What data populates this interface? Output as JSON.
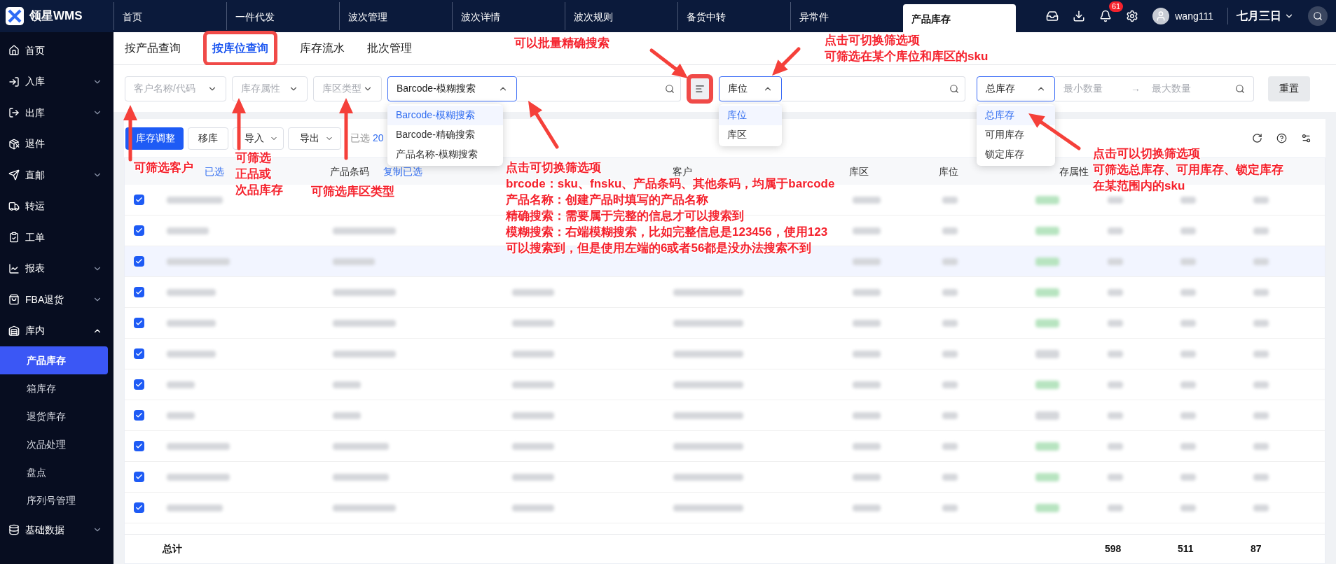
{
  "app": {
    "name": "领星WMS"
  },
  "top_tabs": [
    {
      "label": "首页",
      "selected": false
    },
    {
      "label": "一件代发",
      "selected": false
    },
    {
      "label": "波次管理",
      "selected": false
    },
    {
      "label": "波次详情",
      "selected": false
    },
    {
      "label": "波次规则",
      "selected": false
    },
    {
      "label": "备货中转",
      "selected": false
    },
    {
      "label": "异常件",
      "selected": false
    },
    {
      "label": "产品库存",
      "selected": true
    }
  ],
  "top_right": {
    "notification_count": "61",
    "user": "wang111",
    "date": "七月三日"
  },
  "sidebar": {
    "items": [
      {
        "label": "首页"
      },
      {
        "label": "入库",
        "expanded": false
      },
      {
        "label": "出库",
        "expanded": false
      },
      {
        "label": "退件"
      },
      {
        "label": "直邮",
        "expanded": false
      },
      {
        "label": "转运"
      },
      {
        "label": "工单"
      },
      {
        "label": "报表",
        "expanded": false
      },
      {
        "label": "FBA退货",
        "expanded": false
      },
      {
        "label": "库内",
        "expanded": true,
        "children": [
          {
            "label": "产品库存",
            "selected": true
          },
          {
            "label": "箱库存",
            "selected": false
          },
          {
            "label": "退货库存",
            "selected": false
          },
          {
            "label": "次品处理",
            "selected": false
          },
          {
            "label": "盘点",
            "selected": false
          },
          {
            "label": "序列号管理",
            "selected": false
          }
        ]
      },
      {
        "label": "基础数据",
        "expanded": false
      }
    ]
  },
  "sub_tabs": [
    {
      "label": "按产品查询",
      "selected": false
    },
    {
      "label": "按库位查询",
      "selected": true
    },
    {
      "label": "库存流水",
      "selected": false
    },
    {
      "label": "批次管理",
      "selected": false
    }
  ],
  "filters": {
    "customer": {
      "placeholder": "客户名称/代码"
    },
    "stock_attribute": {
      "placeholder": "库存属性"
    },
    "zone_type": {
      "placeholder": "库区类型"
    },
    "barcode_mode": {
      "value": "Barcode-模糊搜索",
      "options": [
        {
          "label": "Barcode-模糊搜索",
          "selected": true
        },
        {
          "label": "Barcode-精确搜索",
          "selected": false
        },
        {
          "label": "产品名称-模糊搜索",
          "selected": false
        }
      ]
    },
    "location_mode": {
      "value": "库位",
      "options": [
        {
          "label": "库位",
          "selected": true
        },
        {
          "label": "库区",
          "selected": false
        }
      ]
    },
    "quantity_mode": {
      "value": "总库存",
      "options": [
        {
          "label": "总库存",
          "selected": true
        },
        {
          "label": "可用库存",
          "selected": false
        },
        {
          "label": "锁定库存",
          "selected": false
        }
      ]
    },
    "min": {
      "placeholder": "最小数量"
    },
    "arrow": "→",
    "max": {
      "placeholder": "最大数量"
    },
    "reset": "重置"
  },
  "toolbar": {
    "buttons": [
      {
        "label": "库存调整",
        "kind": "primary"
      },
      {
        "label": "移库",
        "kind": "plain"
      },
      {
        "label": "导入",
        "kind": "menu"
      },
      {
        "label": "导出",
        "kind": "menu"
      }
    ],
    "selected_text": "已选",
    "selected_count": "20"
  },
  "table": {
    "columns": [
      {
        "label": "已选",
        "kind": "link"
      },
      {
        "label": "产品条码",
        "kind": "text"
      },
      {
        "label": "复制已选",
        "kind": "link"
      },
      {
        "label": "客户",
        "kind": "text"
      },
      {
        "label": "库区",
        "kind": "text"
      },
      {
        "label": "库位",
        "kind": "text"
      },
      {
        "label": "存属性",
        "kind": "text"
      }
    ],
    "rows": [
      {
        "checked": true,
        "hovered": false,
        "good": true
      },
      {
        "checked": true,
        "hovered": false,
        "good": true
      },
      {
        "checked": true,
        "hovered": true,
        "good": true
      },
      {
        "checked": true,
        "hovered": false,
        "good": true
      },
      {
        "checked": true,
        "hovered": false,
        "good": true
      },
      {
        "checked": true,
        "hovered": false,
        "good": false
      },
      {
        "checked": true,
        "hovered": false,
        "good": true
      },
      {
        "checked": true,
        "hovered": false,
        "good": false
      },
      {
        "checked": true,
        "hovered": false,
        "good": true
      },
      {
        "checked": true,
        "hovered": false,
        "good": true
      },
      {
        "checked": true,
        "hovered": false,
        "good": true
      }
    ],
    "total": {
      "label": "总计",
      "values": [
        "598",
        "511",
        "87"
      ]
    }
  },
  "annotations": {
    "batch": "可以批量精确搜索",
    "location": [
      "点击可切换筛选项",
      "可筛选在某个库位和库区的sku"
    ],
    "customer": "可筛选客户",
    "attribute": [
      "可筛选",
      "正品或",
      "次品库存"
    ],
    "zone": "可筛选库区类型",
    "barcode": [
      "点击可切换筛选项",
      "brcode：sku、fnsku、产品条码、其他条码，均属于barcode",
      "产品名称：创建产品时填写的产品名称",
      "精确搜索：需要属于完整的信息才可以搜索到",
      "模糊搜索：右端模糊搜索，比如完整信息是123456，使用123",
      "可以搜索到，但是使用左端的6或者56都是没办法搜索不到"
    ],
    "quantity": [
      "点击可以切换筛选项",
      "可筛选总库存、可用库存、锁定库存",
      "在某范围内的sku"
    ]
  }
}
